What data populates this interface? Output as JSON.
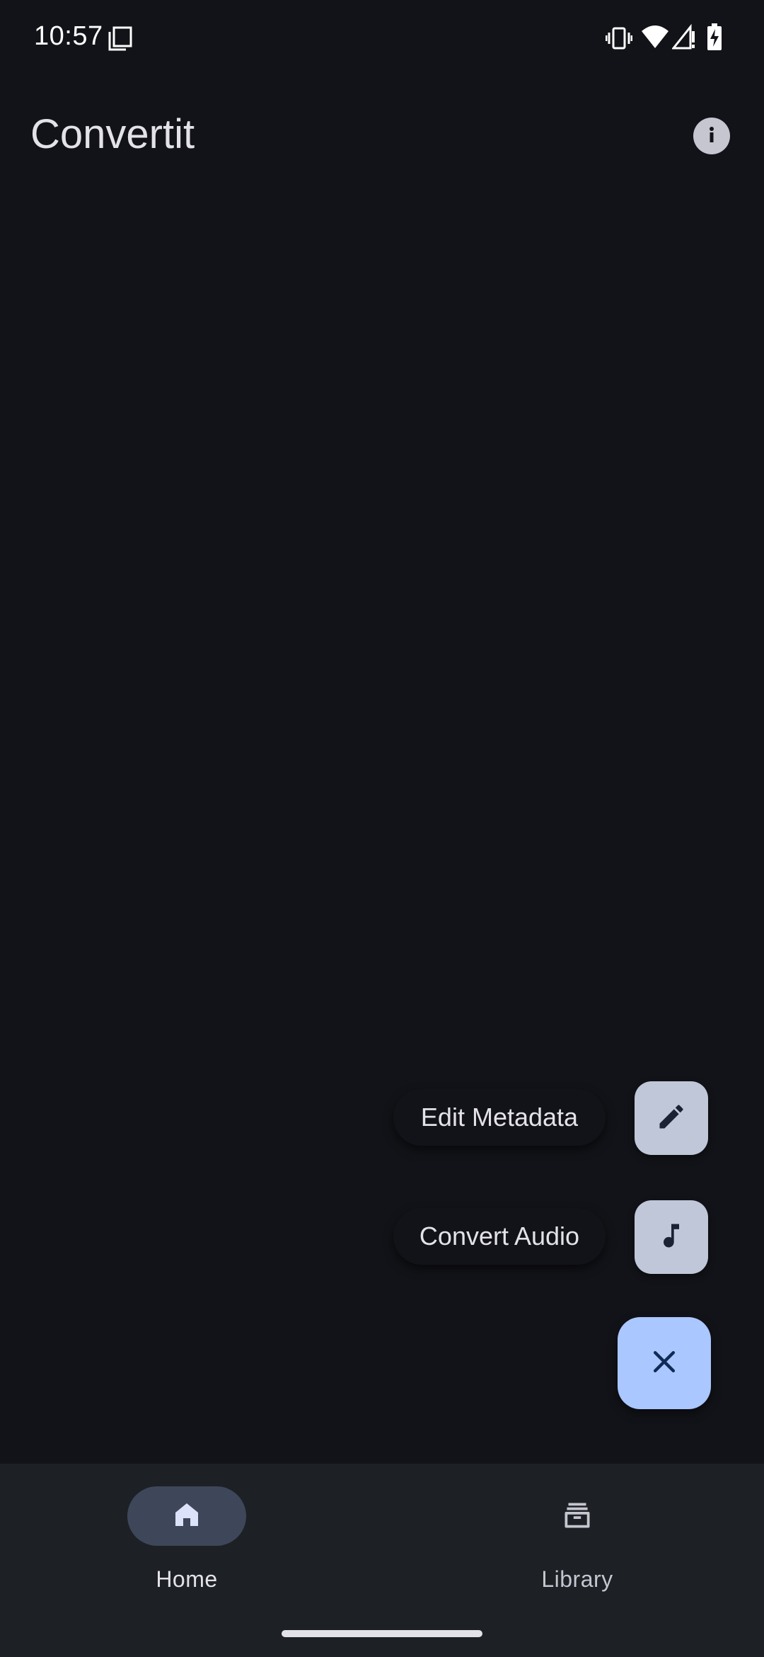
{
  "status_bar": {
    "time": "10:57",
    "icons": [
      "screenshot-icon",
      "vibrate-icon",
      "wifi-icon",
      "signal-icon",
      "battery-charging-icon"
    ]
  },
  "app_bar": {
    "title": "Convertit",
    "info_icon": "info-icon"
  },
  "fab_menu": {
    "items": [
      {
        "label": "Edit Metadata",
        "icon": "pencil-icon"
      },
      {
        "label": "Convert Audio",
        "icon": "music-note-icon"
      }
    ],
    "close_icon": "close-icon"
  },
  "bottom_nav": {
    "items": [
      {
        "label": "Home",
        "icon": "home-icon",
        "selected": true
      },
      {
        "label": "Library",
        "icon": "archive-icon",
        "selected": false
      }
    ]
  },
  "colors": {
    "background": "#121318",
    "nav_background": "#1d2025",
    "primary_container": "#aac7ff",
    "secondary_container": "#c0c7d9",
    "nav_indicator": "#3e4759",
    "on_surface": "#e3e2e9"
  }
}
